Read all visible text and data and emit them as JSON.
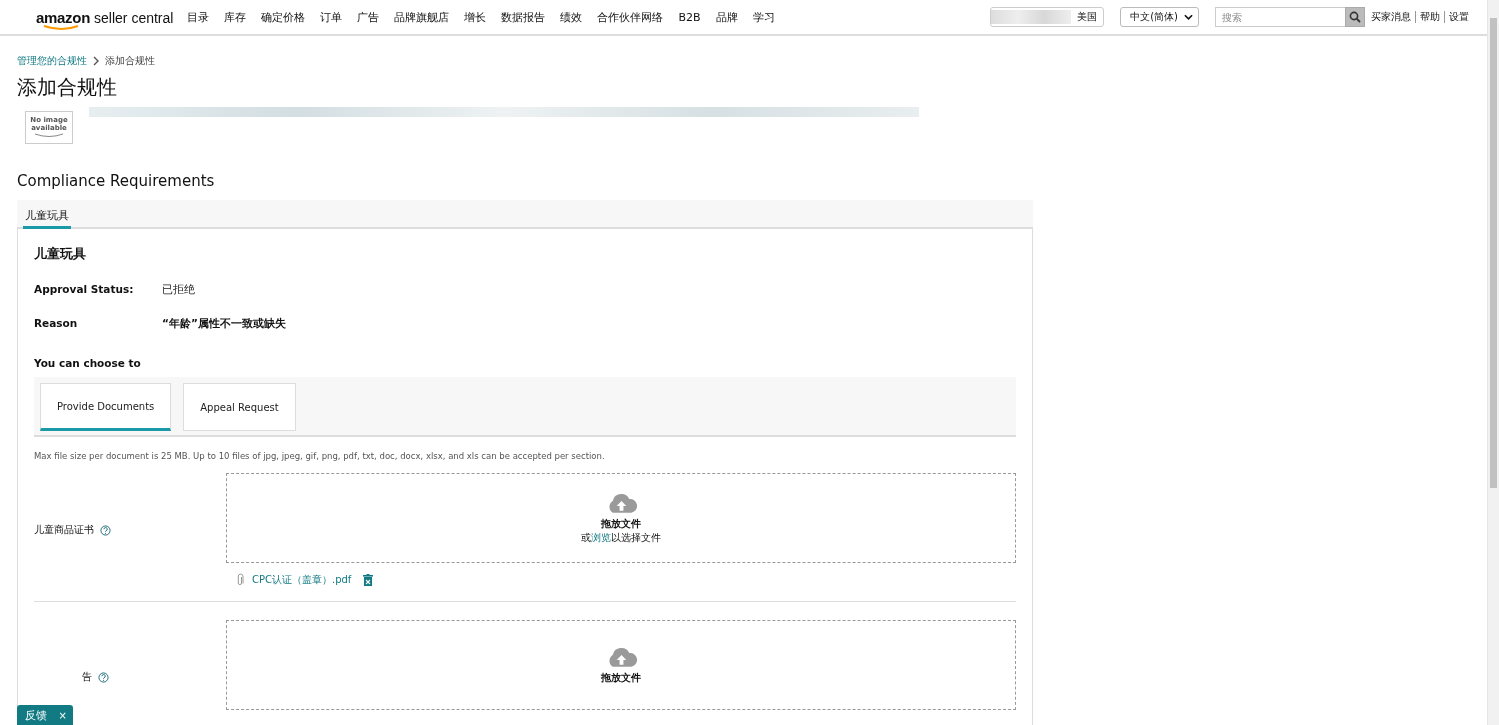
{
  "header": {
    "brand": {
      "name": "amazon",
      "product": "seller central"
    },
    "nav": [
      "目录",
      "库存",
      "确定价格",
      "订单",
      "广告",
      "品牌旗舰店",
      "增长",
      "数据报告",
      "绩效",
      "合作伙伴网络",
      "B2B",
      "品牌",
      "学习"
    ],
    "marketplace": "美国",
    "language": "中文(简体)",
    "search": {
      "placeholder": "搜索"
    },
    "links": [
      "买家消息",
      "帮助",
      "设置"
    ]
  },
  "breadcrumb": [
    "管理您的合规性",
    "添加合规性"
  ],
  "title": "添加合规性",
  "product": {
    "image_text": "No image available"
  },
  "section_heading": "Compliance Requirements",
  "tabs": [
    {
      "label": "儿童玩具",
      "selected": true
    }
  ],
  "panel": {
    "title": "儿童玩具",
    "fields": [
      {
        "kind": "status",
        "label": "Approval Status:",
        "value": "已拒绝"
      },
      {
        "kind": "reason",
        "label": "Reason",
        "value": "“年龄”属性不一致或缺失"
      }
    ],
    "choose_label": "You can choose to",
    "options": [
      {
        "label": "Provide Documents",
        "selected": true
      },
      {
        "label": "Appeal Request",
        "selected": false
      }
    ],
    "note": "Max file size per document is 25 MB. Up to 10 files of jpg, jpeg, gif, png, pdf, txt, doc, docx, xlsx, and xls can be accepted per section.",
    "uploads": [
      {
        "label": "儿童商品证书",
        "drop_title": "拖放文件",
        "hint": {
          "before": "或",
          "link": "浏览",
          "after": "以选择文件"
        },
        "files": [
          "CPC认证（盖章）.pdf"
        ]
      },
      {
        "label": "告",
        "drop_title": "拖放文件"
      }
    ]
  },
  "feedback": {
    "label": "反馈",
    "close": "×"
  }
}
